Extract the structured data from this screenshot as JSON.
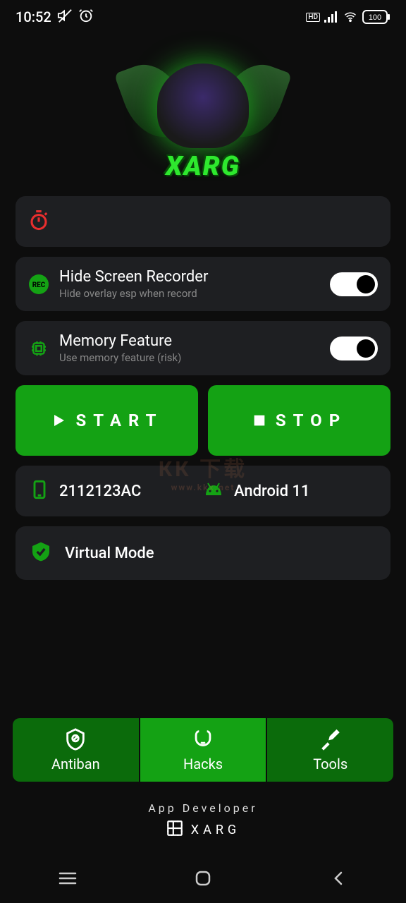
{
  "status": {
    "time": "10:52",
    "battery": "100",
    "net": "HD"
  },
  "logo": {
    "text": "XARG"
  },
  "cards": {
    "hide_recorder": {
      "title": "Hide Screen Recorder",
      "sub": "Hide overlay esp when record"
    },
    "memory": {
      "title": "Memory Feature",
      "sub": "Use memory feature (risk)"
    }
  },
  "buttons": {
    "start": "START",
    "stop": "STOP"
  },
  "device": {
    "model": "2112123AC",
    "os": "Android 11"
  },
  "virtual": {
    "label": "Virtual Mode"
  },
  "tabs": {
    "antiban": "Antiban",
    "hacks": "Hacks",
    "tools": "Tools"
  },
  "footer": {
    "dev_label": "App Developer",
    "dev_name": "XARG"
  },
  "watermark": {
    "big": "КК 下载",
    "small": "www.kkx.net"
  },
  "colors": {
    "accent": "#14a214",
    "card": "#1e1f22"
  }
}
